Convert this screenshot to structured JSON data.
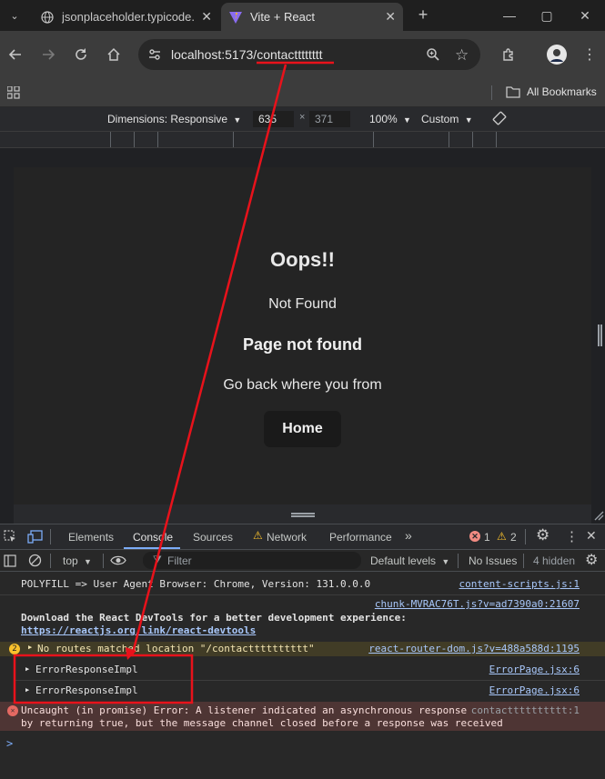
{
  "tabs": [
    {
      "title": "jsonplaceholder.typicode.",
      "active": false
    },
    {
      "title": "Vite + React",
      "active": true
    }
  ],
  "toolbar": {
    "url_host": "localhost:5173/",
    "url_path": "contactttttttt"
  },
  "bookmarks": {
    "all_label": "All Bookmarks"
  },
  "device_toolbar": {
    "dimensions_label": "Dimensions: Responsive",
    "width_value": "635",
    "height_value": "371",
    "zoom_label": "100%",
    "throttle_label": "Custom"
  },
  "page": {
    "heading": "Oops!!",
    "status_text": "Not Found",
    "subheading": "Page not found",
    "message": "Go back where you from",
    "home_button": "Home"
  },
  "devtools": {
    "tabs": [
      "Elements",
      "Console",
      "Sources",
      "Network",
      "Performance"
    ],
    "active_tab": "Console",
    "error_count": "1",
    "warning_count": "2",
    "context": "top",
    "filter_placeholder": "Filter",
    "levels_label": "Default levels",
    "issues_label": "No Issues",
    "hidden_label": "4 hidden"
  },
  "console": {
    "line1_text": "POLYFILL => User Agent Browser: Chrome, Version: 131.0.0.0",
    "line1_src": "content-scripts.js:1",
    "line2_src": "chunk-MVRAC76T.js?v=ad7390a0:21607",
    "line2_text": "Download the React DevTools for a better development experience:",
    "line2_link": "https://reactjs.org/link/react-devtools",
    "warn_count": "2",
    "warn_text": "No routes matched location \"/contactttttttttt\"",
    "warn_src": "react-router-dom.js?v=488a588d:1195",
    "obj1": "ErrorResponseImpl",
    "obj1_src": "ErrorPage.jsx:6",
    "obj2": "ErrorResponseImpl",
    "obj2_src": "ErrorPage.jsx:6",
    "err_line1": "Uncaught (in promise) Error: A listener indicated an asynchronous response",
    "err_line2": "by returning true, but the message channel closed before a response was received",
    "err_src": "contactttttttttt:1",
    "prompt": ">"
  },
  "colors": {
    "annotation": "#e8121b",
    "link": "#a8c7fa",
    "error_bg": "#4e3534",
    "warning_bg": "#413c26"
  }
}
